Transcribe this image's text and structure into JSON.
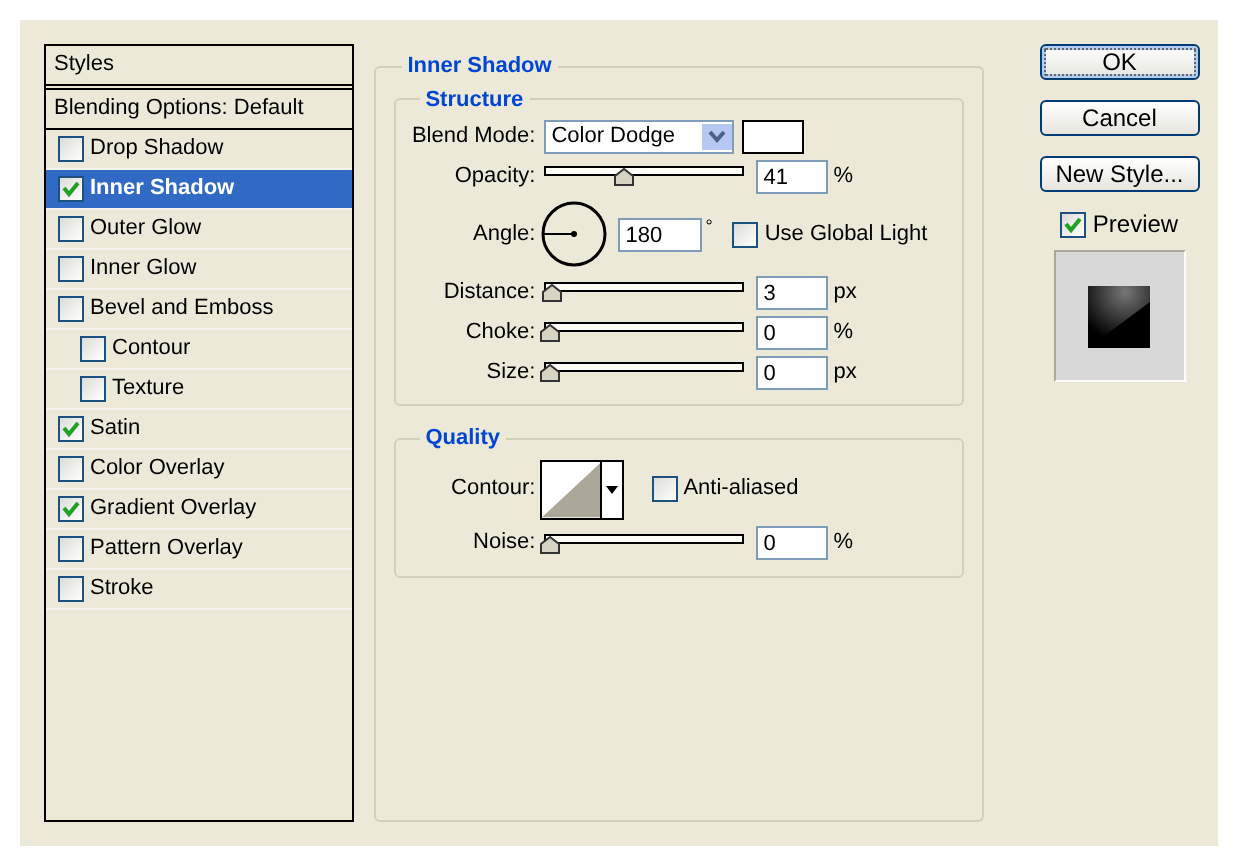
{
  "styles": {
    "title": "Styles",
    "header": "Blending Options: Default",
    "items": [
      {
        "label": "Drop Shadow",
        "checked": false,
        "selected": false
      },
      {
        "label": "Inner Shadow",
        "checked": true,
        "selected": true
      },
      {
        "label": "Outer Glow",
        "checked": false,
        "selected": false
      },
      {
        "label": "Inner Glow",
        "checked": false,
        "selected": false
      },
      {
        "label": "Bevel and Emboss",
        "checked": false,
        "selected": false,
        "children": [
          {
            "label": "Contour",
            "checked": false,
            "selected": false
          },
          {
            "label": "Texture",
            "checked": false,
            "selected": false
          }
        ]
      },
      {
        "label": "Satin",
        "checked": true,
        "selected": false
      },
      {
        "label": "Color Overlay",
        "checked": false,
        "selected": false
      },
      {
        "label": "Gradient Overlay",
        "checked": true,
        "selected": false
      },
      {
        "label": "Pattern Overlay",
        "checked": false,
        "selected": false
      },
      {
        "label": "Stroke",
        "checked": false,
        "selected": false
      }
    ]
  },
  "panel": {
    "title": "Inner Shadow",
    "groups": [
      {
        "title": "Structure",
        "rows": [
          {
            "kind": "select",
            "label": "Blend Mode:",
            "value": "Color Dodge"
          },
          {
            "kind": "slider",
            "label": "Opacity:",
            "level": 0.41,
            "value": "41",
            "unit": "%"
          },
          {
            "kind": "angle",
            "label": "Angle:",
            "value": "180",
            "unit": "°",
            "checkbox": {
              "label": "Use Global Light",
              "checked": false
            }
          },
          {
            "kind": "slider",
            "label": "Distance:",
            "level": 0.01,
            "value": "3",
            "unit": "px"
          },
          {
            "kind": "slider",
            "label": "Choke:",
            "level": 0,
            "value": "0",
            "unit": "%"
          },
          {
            "kind": "slider",
            "label": "Size:",
            "level": 0,
            "value": "0",
            "unit": "px"
          }
        ]
      },
      {
        "title": "Quality",
        "rows": [
          {
            "kind": "contour",
            "label": "Contour:",
            "checkbox": {
              "label": "Anti-aliased",
              "checked": false
            }
          },
          {
            "kind": "slider",
            "label": "Noise:",
            "level": 0,
            "value": "0",
            "unit": "%"
          }
        ]
      }
    ]
  },
  "buttons": [
    {
      "label": "OK",
      "focused": true
    },
    {
      "label": "Cancel",
      "focused": false
    },
    {
      "label": "New Style...",
      "focused": false
    }
  ],
  "preview": {
    "label": "Preview",
    "checked": true
  }
}
